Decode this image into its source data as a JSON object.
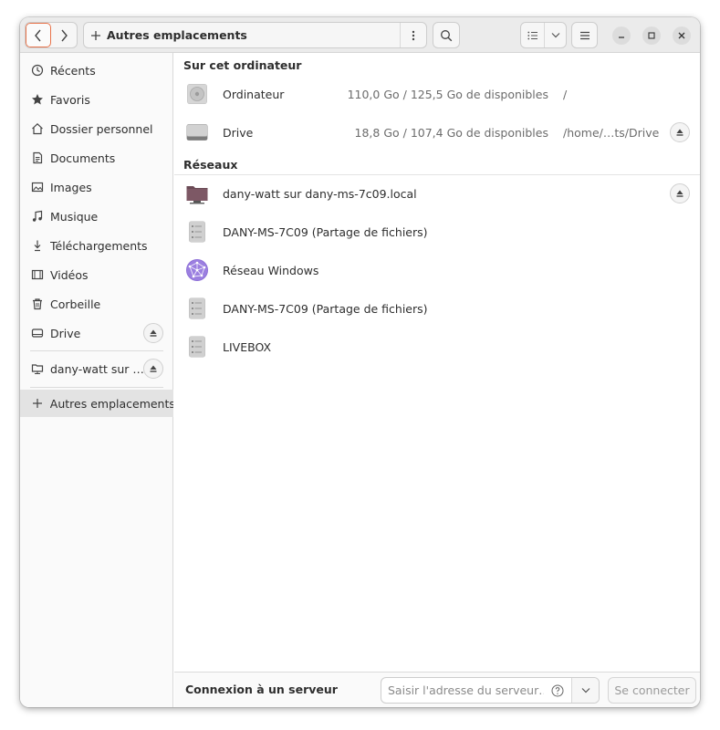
{
  "header": {
    "path_label": "Autres emplacements",
    "path_icon": "plus-icon"
  },
  "sidebar": {
    "items": [
      {
        "label": "Récents",
        "icon": "clock-icon"
      },
      {
        "label": "Favoris",
        "icon": "star-icon"
      },
      {
        "label": "Dossier personnel",
        "icon": "home-icon"
      },
      {
        "label": "Documents",
        "icon": "document-icon"
      },
      {
        "label": "Images",
        "icon": "image-icon"
      },
      {
        "label": "Musique",
        "icon": "music-icon"
      },
      {
        "label": "Téléchargements",
        "icon": "download-icon"
      },
      {
        "label": "Vidéos",
        "icon": "video-icon"
      },
      {
        "label": "Corbeille",
        "icon": "trash-icon"
      },
      {
        "label": "Drive",
        "icon": "drive-icon",
        "eject": true
      }
    ],
    "network_item": {
      "label": "dany-watt sur …",
      "icon": "network-folder-icon",
      "eject": true
    },
    "other_locations": {
      "label": "Autres emplacements",
      "icon": "plus-icon",
      "active": true
    }
  },
  "main": {
    "section_computer": "Sur cet ordinateur",
    "computer_items": [
      {
        "name": "Ordinateur",
        "info": "110,0 Go / 125,5 Go de disponibles",
        "path": "/",
        "icon": "disk-icon",
        "eject": false
      },
      {
        "name": "Drive",
        "info": "18,8 Go / 107,4 Go de disponibles",
        "path": "/home/…ts/Drive",
        "icon": "drive-icon",
        "eject": true
      }
    ],
    "section_networks": "Réseaux",
    "network_items": [
      {
        "name": "dany-watt sur dany-ms-7c09.local",
        "icon": "network-folder-icon",
        "eject": true
      },
      {
        "name": "DANY-MS-7C09 (Partage de fichiers)",
        "icon": "server-icon",
        "eject": false
      },
      {
        "name": "Réseau Windows",
        "icon": "network-globe-icon",
        "eject": false
      },
      {
        "name": "DANY-MS-7C09 (Partage de fichiers)",
        "icon": "server-icon",
        "eject": false
      },
      {
        "name": "LIVEBOX",
        "icon": "server-icon",
        "eject": false
      }
    ]
  },
  "bottom": {
    "label": "Connexion à un serveur",
    "address_placeholder": "Saisir l'adresse du serveur…",
    "connect_label": "Se connecter"
  }
}
